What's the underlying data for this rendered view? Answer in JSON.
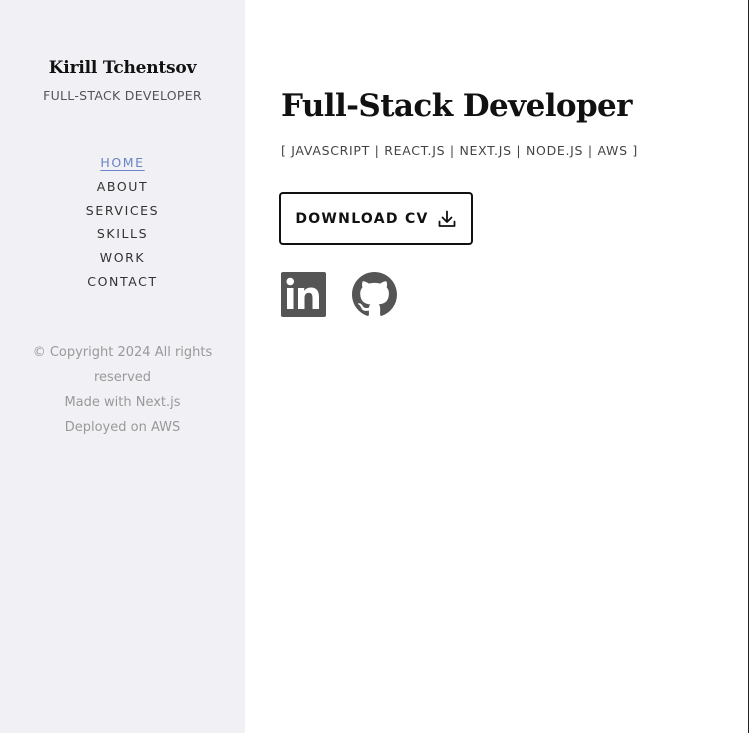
{
  "sidebar": {
    "name": "Kirill Tchentsov",
    "role": "FULL-STACK DEVELOPER",
    "nav": [
      {
        "label": "HOME",
        "active": true
      },
      {
        "label": "ABOUT",
        "active": false
      },
      {
        "label": "SERVICES",
        "active": false
      },
      {
        "label": "SKILLS",
        "active": false
      },
      {
        "label": "WORK",
        "active": false
      },
      {
        "label": "CONTACT",
        "active": false
      }
    ],
    "footer": {
      "copyright": "© Copyright 2024 All rights reserved",
      "made_with": "Made with Next.js",
      "deployed": "Deployed on AWS"
    }
  },
  "main": {
    "title": "Full-Stack Developer",
    "stack": "[ JAVASCRIPT | REACT.JS | NEXT.JS | NODE.JS | AWS ]",
    "cv_button_label": "DOWNLOAD CV",
    "cv_icon": "download-icon",
    "socials": [
      {
        "icon": "linkedin-icon"
      },
      {
        "icon": "github-icon"
      }
    ]
  },
  "colors": {
    "sidebar_bg": "#f1f1f5",
    "active_nav": "#6a83c9",
    "text_dark": "#111111",
    "text_muted": "#999999",
    "social_icon": "#555555"
  }
}
